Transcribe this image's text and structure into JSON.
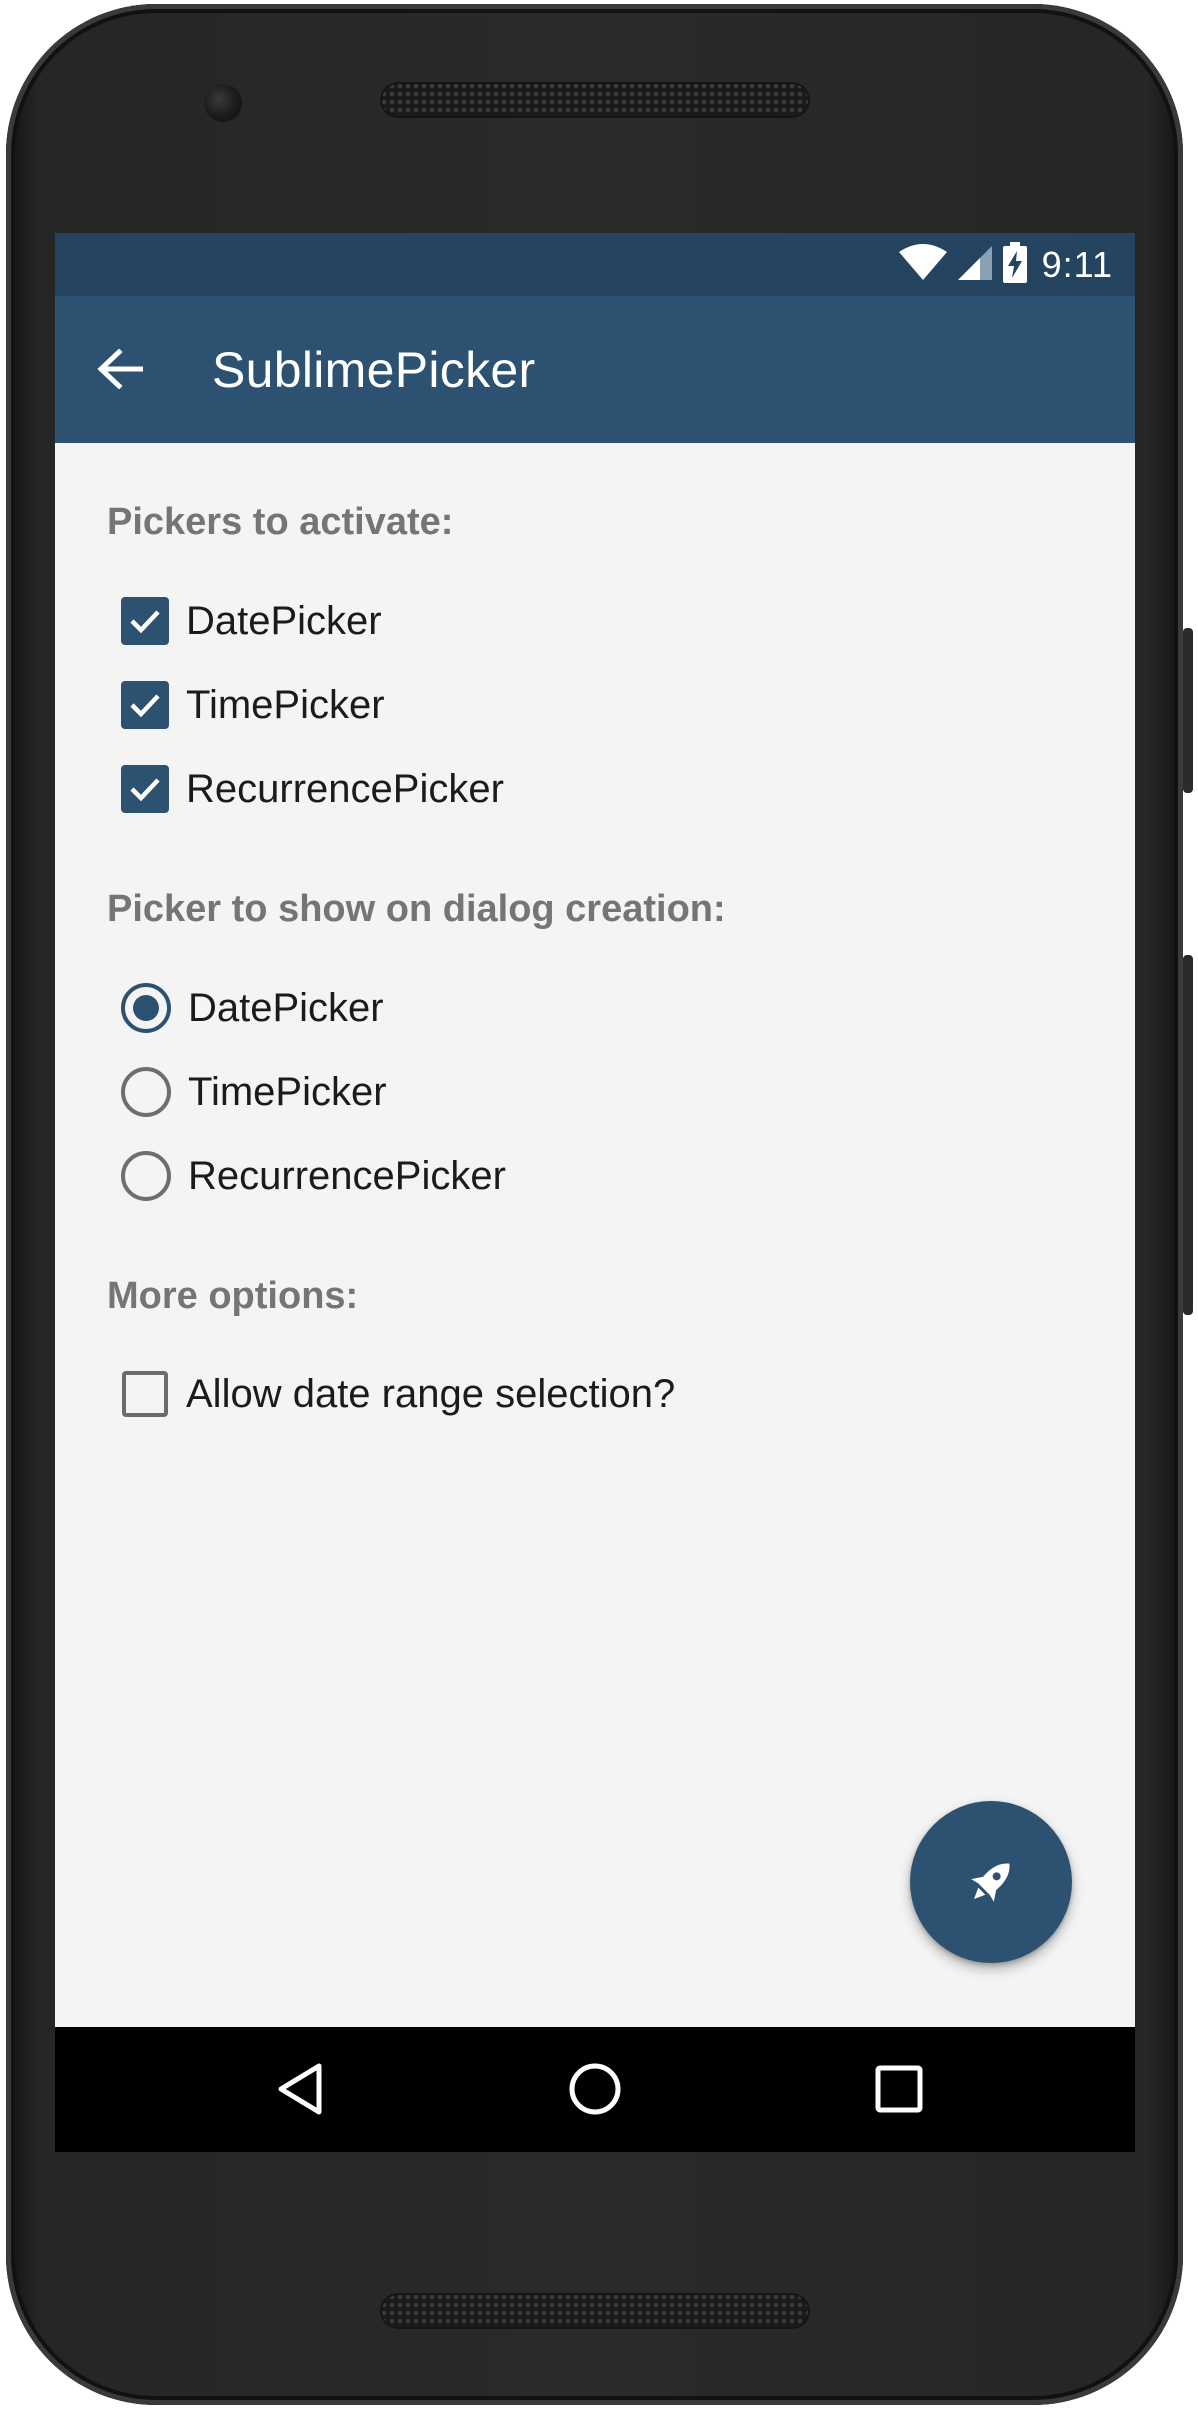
{
  "status_bar": {
    "time": "9:11",
    "icons": [
      "wifi-icon",
      "cell-signal-icon",
      "battery-charging-icon"
    ]
  },
  "app_bar": {
    "title": "SublimePicker",
    "back_icon": "arrow-back-icon"
  },
  "sections": {
    "pickers_to_activate": {
      "title": "Pickers to activate:",
      "items": [
        {
          "label": "DatePicker",
          "checked": true
        },
        {
          "label": "TimePicker",
          "checked": true
        },
        {
          "label": "RecurrencePicker",
          "checked": true
        }
      ]
    },
    "picker_on_creation": {
      "title": "Picker to show on dialog creation:",
      "items": [
        {
          "label": "DatePicker",
          "selected": true
        },
        {
          "label": "TimePicker",
          "selected": false
        },
        {
          "label": "RecurrencePicker",
          "selected": false
        }
      ]
    },
    "more_options": {
      "title": "More options:",
      "items": [
        {
          "label": "Allow date range selection?",
          "checked": false
        }
      ]
    }
  },
  "fab": {
    "icon": "rocket-icon"
  },
  "nav_bar": {
    "icons": [
      "nav-back-icon",
      "nav-home-icon",
      "nav-recents-icon"
    ]
  },
  "colors": {
    "primary": "#2d5271",
    "primary_dark": "#24445f",
    "background": "#f4f4f4",
    "section_title": "#757575"
  }
}
